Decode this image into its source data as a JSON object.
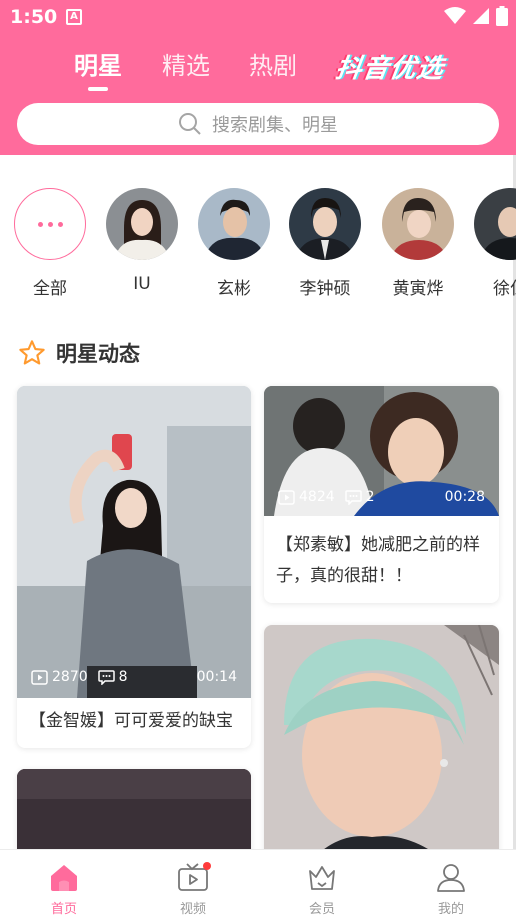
{
  "status_bar": {
    "time": "1:50",
    "notice_icon": "A"
  },
  "top_tabs": [
    {
      "label": "明星",
      "active": true
    },
    {
      "label": "精选",
      "active": false
    },
    {
      "label": "热剧",
      "active": false
    }
  ],
  "brand": "抖音优选",
  "search": {
    "placeholder": "搜索剧集、明星"
  },
  "stars": [
    {
      "name": "全部",
      "icon": "more-dots-icon"
    },
    {
      "name": "IU"
    },
    {
      "name": "玄彬"
    },
    {
      "name": "李钟硕"
    },
    {
      "name": "黄寅烨"
    },
    {
      "name": "徐仁"
    }
  ],
  "section": {
    "title": "明星动态",
    "icon": "star-outline-icon"
  },
  "feed": [
    {
      "plays": "2870",
      "comments": "8",
      "duration": "00:14",
      "title": "【金智媛】可可爱爱的缺宝"
    },
    {
      "plays": "4824",
      "comments": "2",
      "duration": "00:28",
      "title": "【郑素敏】她减肥之前的样子，真的很甜！！"
    }
  ],
  "bottom_nav": [
    {
      "label": "首页",
      "icon": "home-icon",
      "active": true
    },
    {
      "label": "视频",
      "icon": "tv-icon",
      "active": false
    },
    {
      "label": "会员",
      "icon": "crown-icon",
      "active": false
    },
    {
      "label": "我的",
      "icon": "user-icon",
      "active": false
    }
  ],
  "colors": {
    "accent": "#ff6b9c",
    "badge_red": "#ff3b3b"
  }
}
